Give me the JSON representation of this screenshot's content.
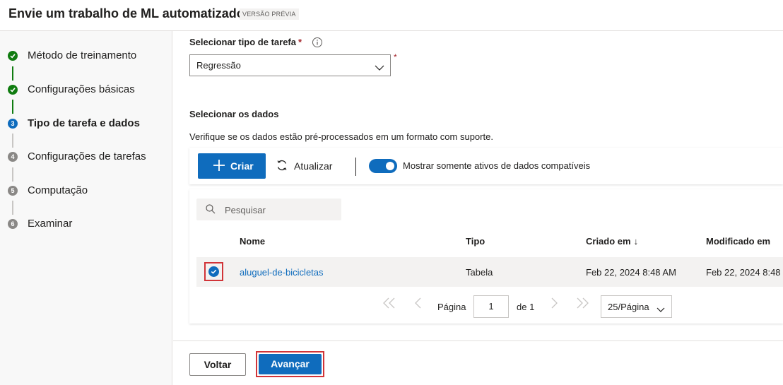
{
  "header": {
    "title": "Envie um trabalho de ML automatizado",
    "badge": "VERSÃO PRÉVIA"
  },
  "steps": [
    {
      "label": "Método de treinamento",
      "state": "done",
      "number": "1"
    },
    {
      "label": "Configurações básicas",
      "state": "done",
      "number": "2"
    },
    {
      "label": "Tipo de tarefa e dados",
      "state": "current",
      "number": "3"
    },
    {
      "label": "Configurações de tarefas",
      "state": "todo",
      "number": "4"
    },
    {
      "label": "Computação",
      "state": "todo",
      "number": "5"
    },
    {
      "label": "Examinar",
      "state": "todo",
      "number": "6"
    }
  ],
  "task_type": {
    "label": "Selecionar tipo de tarefa",
    "required_mark": "*",
    "selected": "Regressão"
  },
  "data_section": {
    "title": "Selecionar os dados",
    "description": "Verifique se os dados estão pré-processados em um formato com suporte."
  },
  "toolbar": {
    "create_label": "Criar",
    "refresh_label": "Atualizar",
    "toggle_label": "Mostrar somente ativos de dados compatíveis",
    "toggle_on": true
  },
  "grid": {
    "search_placeholder": "Pesquisar",
    "columns": [
      "Nome",
      "Tipo",
      "Criado em",
      "Modificado em"
    ],
    "sort_indicator": "↓",
    "rows": [
      {
        "name": "aluguel-de-bicicletas",
        "type": "Tabela",
        "created": "Feb 22, 2024 8:48 AM",
        "modified": "Feb 22, 2024 8:48",
        "selected": true
      }
    ]
  },
  "pager": {
    "page_label": "Página",
    "page_value": "1",
    "of_label": "de 1",
    "page_size": "25/Página"
  },
  "footer": {
    "back_label": "Voltar",
    "next_label": "Avançar"
  },
  "colors": {
    "accent": "#0f6cbd",
    "done": "#107c10",
    "highlight": "#d13438"
  }
}
